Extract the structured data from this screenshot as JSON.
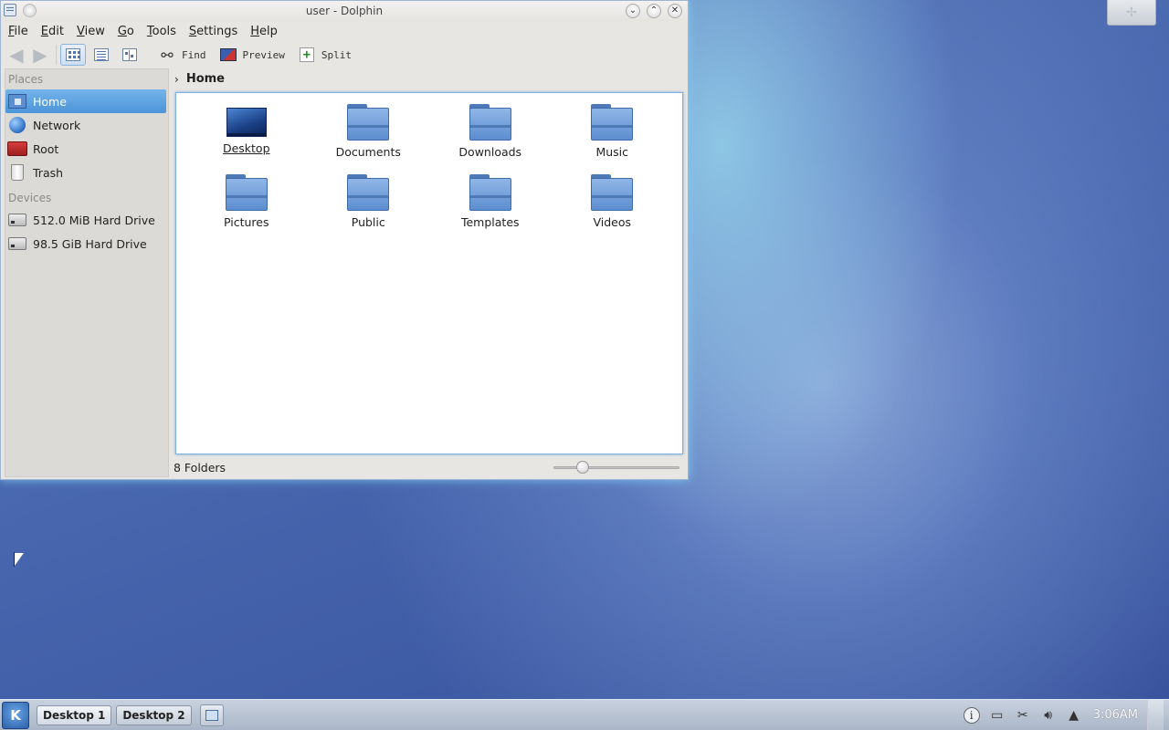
{
  "window": {
    "title": "user - Dolphin",
    "buttons": {
      "minimize": "⌄",
      "maximize": "⌃",
      "close": "✕"
    }
  },
  "menu": [
    "File",
    "Edit",
    "View",
    "Go",
    "Tools",
    "Settings",
    "Help"
  ],
  "toolbar": {
    "find_label": "Find",
    "preview_label": "Preview",
    "split_label": "Split"
  },
  "places": {
    "places_header": "Places",
    "items": [
      {
        "label": "Home",
        "icon": "home-folder-icon",
        "selected": true
      },
      {
        "label": "Network",
        "icon": "network-globe-icon"
      },
      {
        "label": "Root",
        "icon": "root-folder-icon"
      },
      {
        "label": "Trash",
        "icon": "trash-icon"
      }
    ],
    "devices_header": "Devices",
    "devices": [
      {
        "label": "512.0 MiB Hard Drive",
        "icon": "hard-drive-icon"
      },
      {
        "label": "98.5 GiB Hard Drive",
        "icon": "hard-drive-icon"
      }
    ]
  },
  "breadcrumb": {
    "chevron": "›",
    "current": "Home"
  },
  "files": [
    {
      "label": "Desktop",
      "icon": "desktop-folder-icon"
    },
    {
      "label": "Documents",
      "icon": "folder-icon"
    },
    {
      "label": "Downloads",
      "icon": "folder-icon"
    },
    {
      "label": "Music",
      "icon": "folder-icon"
    },
    {
      "label": "Pictures",
      "icon": "folder-icon"
    },
    {
      "label": "Public",
      "icon": "folder-icon"
    },
    {
      "label": "Templates",
      "icon": "folder-icon"
    },
    {
      "label": "Videos",
      "icon": "folder-icon"
    }
  ],
  "statusbar": {
    "text": "8 Folders",
    "zoom_fraction": 0.2
  },
  "taskbar": {
    "kmenu_label": "K",
    "desktops": [
      "Desktop 1",
      "Desktop 2"
    ],
    "clock": "3:06AM",
    "tray_icons": [
      "info-icon",
      "network-icon",
      "clipboard-icon",
      "volume-icon",
      "expand-arrow-icon"
    ]
  },
  "colors": {
    "selection": "#4c95d9",
    "folder": "#5d8dcf",
    "desktop_bg": "#4a69b0"
  }
}
